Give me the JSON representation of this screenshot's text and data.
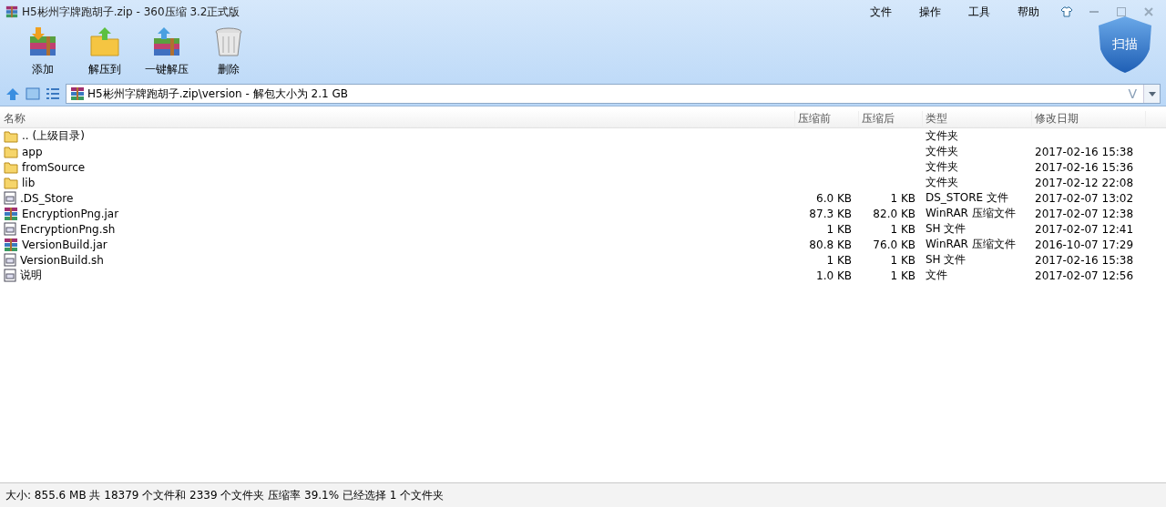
{
  "window": {
    "title": "H5彬州字牌跑胡子.zip - 360压缩 3.2正式版"
  },
  "menu": [
    "文件",
    "操作",
    "工具",
    "帮助"
  ],
  "toolbar": [
    {
      "label": "添加",
      "kind": "add"
    },
    {
      "label": "解压到",
      "kind": "extract"
    },
    {
      "label": "一键解压",
      "kind": "quick"
    },
    {
      "label": "删除",
      "kind": "delete"
    }
  ],
  "scan_button": {
    "label": "扫描"
  },
  "address": {
    "value": "H5彬州字牌跑胡子.zip\\version - 解包大小为 2.1 GB",
    "suffix": "V"
  },
  "table": {
    "columns": [
      "名称",
      "压缩前",
      "压缩后",
      "类型",
      "修改日期"
    ],
    "rows": [
      {
        "kind": "folder",
        "name": ".. (上级目录)",
        "before": "",
        "after": "",
        "type": "文件夹",
        "date": ""
      },
      {
        "kind": "folder",
        "name": "app",
        "before": "",
        "after": "",
        "type": "文件夹",
        "date": "2017-02-16 15:38"
      },
      {
        "kind": "folder",
        "name": "fromSource",
        "before": "",
        "after": "",
        "type": "文件夹",
        "date": "2017-02-16 15:36"
      },
      {
        "kind": "folder",
        "name": "lib",
        "before": "",
        "after": "",
        "type": "文件夹",
        "date": "2017-02-12 22:08"
      },
      {
        "kind": "file",
        "name": ".DS_Store",
        "before": "6.0 KB",
        "after": "1 KB",
        "type": "DS_STORE 文件",
        "date": "2017-02-07 13:02"
      },
      {
        "kind": "archive",
        "name": "EncryptionPng.jar",
        "before": "87.3 KB",
        "after": "82.0 KB",
        "type": "WinRAR 压缩文件",
        "date": "2017-02-07 12:38"
      },
      {
        "kind": "file",
        "name": "EncryptionPng.sh",
        "before": "1 KB",
        "after": "1 KB",
        "type": "SH 文件",
        "date": "2017-02-07 12:41"
      },
      {
        "kind": "archive",
        "name": "VersionBuild.jar",
        "before": "80.8 KB",
        "after": "76.0 KB",
        "type": "WinRAR 压缩文件",
        "date": "2016-10-07 17:29"
      },
      {
        "kind": "file",
        "name": "VersionBuild.sh",
        "before": "1 KB",
        "after": "1 KB",
        "type": "SH 文件",
        "date": "2017-02-16 15:38"
      },
      {
        "kind": "file",
        "name": "说明",
        "before": "1.0 KB",
        "after": "1 KB",
        "type": "文件",
        "date": "2017-02-07 12:56"
      }
    ]
  },
  "status_bar": "大小: 855.6 MB 共 18379 个文件和 2339 个文件夹 压缩率 39.1% 已经选择 1 个文件夹"
}
